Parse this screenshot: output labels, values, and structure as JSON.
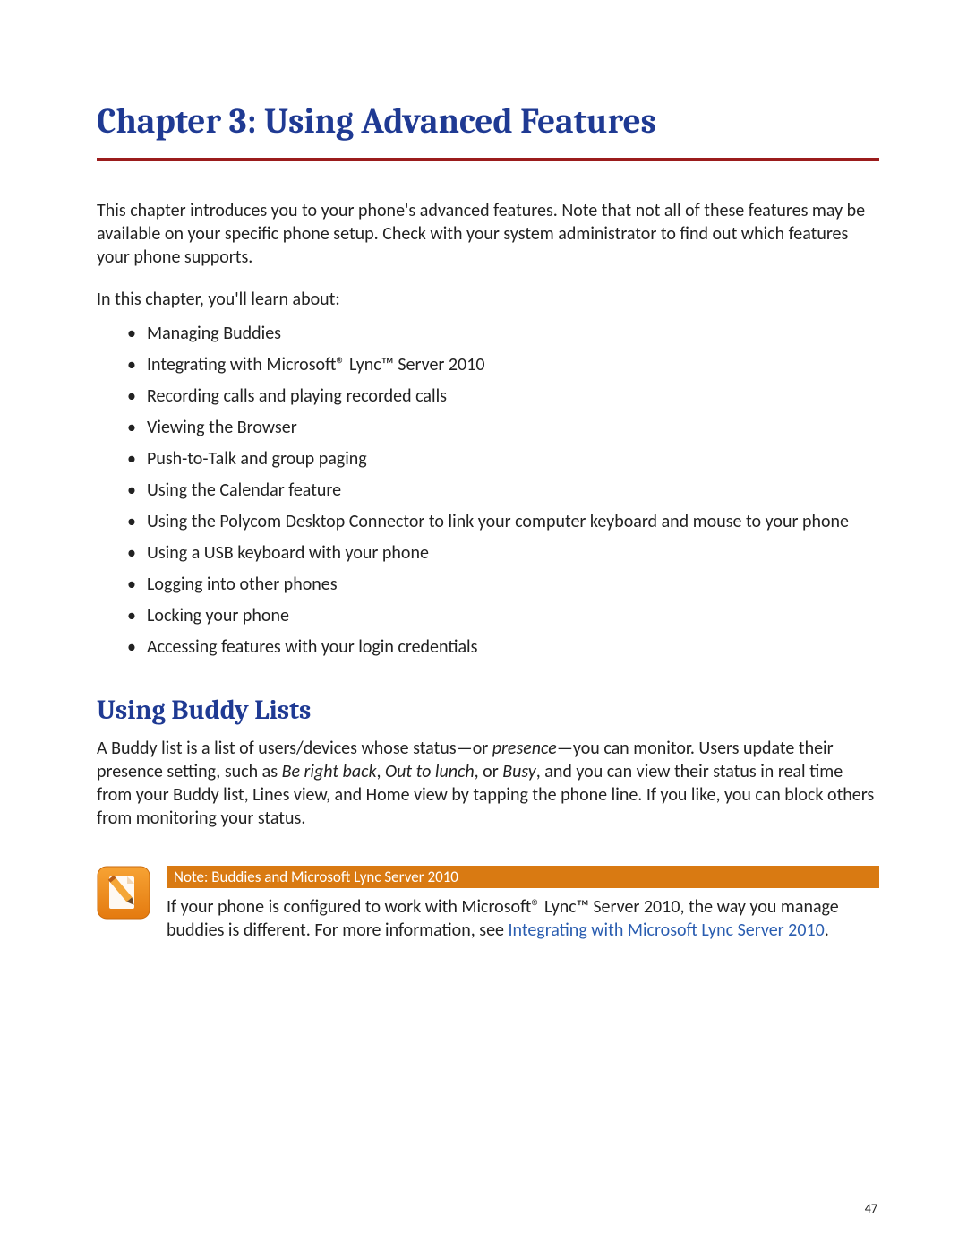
{
  "chapter_title": "Chapter 3: Using Advanced Features",
  "intro_para": "This chapter introduces you to your phone's advanced features. Note that not all of these features may be available on your specific phone setup. Check with your system administrator to find out which features your phone supports.",
  "lead_in": "In this chapter, you'll learn about:",
  "topics": [
    "Managing Buddies",
    "Integrating with Microsoft® Lync™ Server 2010",
    "Recording calls and playing recorded calls",
    "Viewing the Browser",
    "Push-to-Talk and group paging",
    "Using the Calendar feature",
    "Using the Polycom Desktop Connector to link your computer keyboard and mouse to your phone",
    "Using a USB keyboard with your phone",
    "Logging into other phones",
    "Locking your phone",
    "Accessing features with your login credentials"
  ],
  "section_title": "Using Buddy Lists",
  "section_para_html": "A Buddy list is a list of users/devices whose status—or <em>presence</em>—you can monitor. Users update their presence setting, such as <em>Be right back</em>, <em>Out to lunch</em>, or <em>Busy</em>, and you can view their status in real time from your Buddy list, Lines view, and Home view by tapping the phone line. If you like, you can block others from monitoring your status.",
  "note": {
    "header": "Note: Buddies and Microsoft Lync Server 2010",
    "body_prefix": "If your phone is configured to work with Microsoft® Lync™ Server 2010, the way you manage buddies is different. For more information, see ",
    "link_text": "Integrating with Microsoft Lync Server 2010",
    "body_suffix": "."
  },
  "page_number": "47",
  "colors": {
    "heading": "#1f3a93",
    "rule": "#9b1c1c",
    "note_bg": "#d97a12",
    "link": "#2a5db0"
  }
}
